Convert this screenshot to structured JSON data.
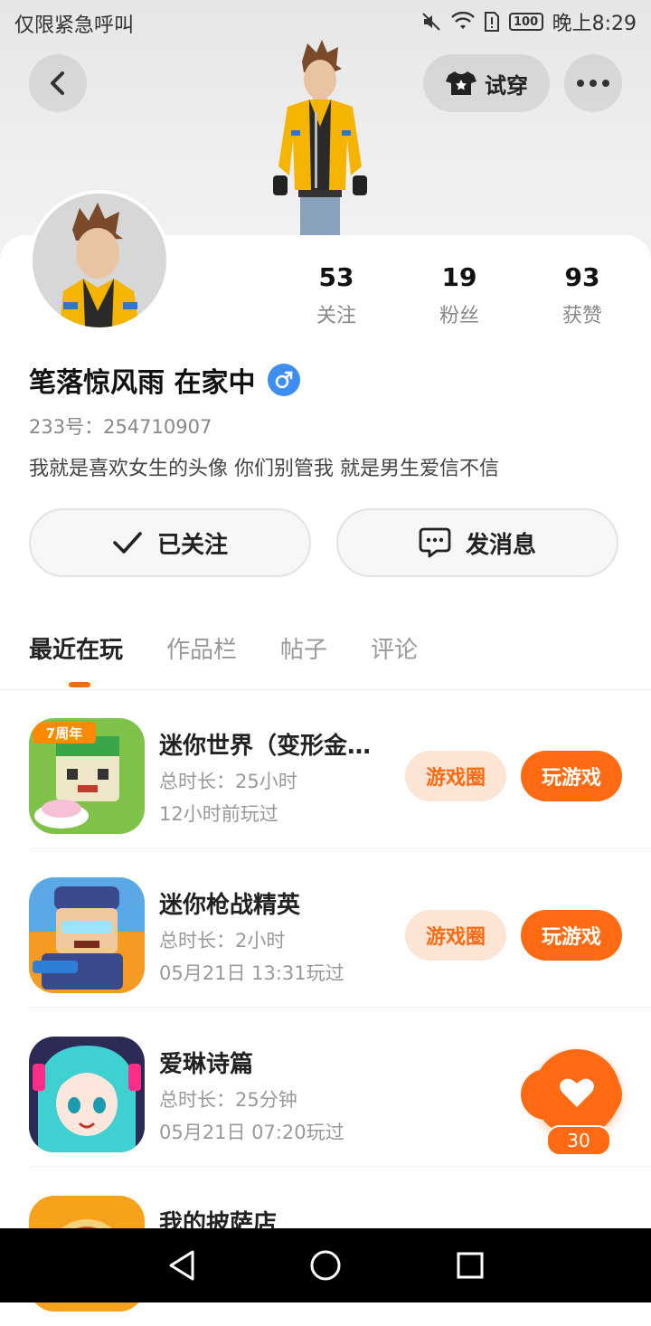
{
  "status_bar": {
    "carrier": "仅限紧急呼叫",
    "battery": "100",
    "time": "晚上8:29"
  },
  "header": {
    "try_on_label": "试穿"
  },
  "profile": {
    "stats": [
      {
        "value": "53",
        "label": "关注"
      },
      {
        "value": "19",
        "label": "粉丝"
      },
      {
        "value": "93",
        "label": "获赞"
      }
    ],
    "name": "笔落惊风雨 在家中",
    "gender_symbol": "♂",
    "uid": "233号：254710907",
    "bio": "我就是喜欢女生的头像 你们别管我 就是男生爱信不信",
    "follow_label": "已关注",
    "message_label": "发消息"
  },
  "tabs": [
    "最近在玩",
    "作品栏",
    "帖子",
    "评论"
  ],
  "games": [
    {
      "name": "迷你世界（变形金…",
      "duration": "总时长：25小时",
      "last_played": "12小时前玩过",
      "circle_label": "游戏圈",
      "play_label": "玩游戏"
    },
    {
      "name": "迷你枪战精英",
      "duration": "总时长：2小时",
      "last_played": "05月21日 13:31玩过",
      "circle_label": "游戏圈",
      "play_label": "玩游戏"
    },
    {
      "name": "爱琳诗篇",
      "duration": "总时长：25分钟",
      "last_played": "05月21日 07:20玩过"
    },
    {
      "name": "我的披萨店"
    }
  ],
  "game_icon_badges": {
    "mini_world": "7周年"
  },
  "like": {
    "count": "30"
  },
  "colors": {
    "accent": "#ff6a13",
    "accent_light": "#fde5d6",
    "gender": "#3d8ef0"
  },
  "icons": [
    "back-arrow-icon",
    "shirt-star-icon",
    "more-dots-icon",
    "check-icon",
    "chat-bubble-icon",
    "heart-icon",
    "nav-back-icon",
    "nav-home-icon",
    "nav-recents-icon"
  ]
}
